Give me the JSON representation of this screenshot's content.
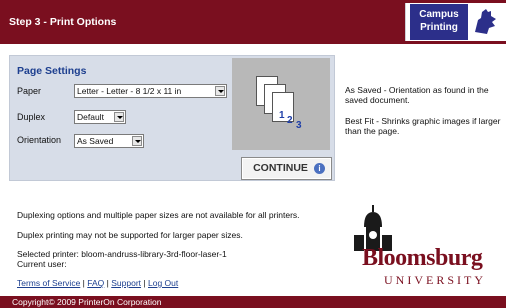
{
  "header": {
    "title": "Step 3 - Print Options",
    "logo_text_line1": "Campus",
    "logo_text_line2": "Printing",
    "color": "#7a0f1f"
  },
  "page_settings": {
    "title": "Page Settings",
    "paper_label": "Paper",
    "paper_value": "Letter - Letter - 8 1/2 x 11 in",
    "duplex_label": "Duplex",
    "duplex_value": "Default",
    "orientation_label": "Orientation",
    "orientation_value": "As Saved"
  },
  "preview": {
    "page_numbers": [
      "1",
      "2",
      "3"
    ]
  },
  "continue_label": "CONTINUE",
  "descriptions": [
    "As Saved - Orientation as found in the saved document.",
    "Best Fit - Shrinks graphic images if larger than the page."
  ],
  "notes": {
    "line1": "Duplexing options and multiple paper sizes are not available for all printers.",
    "line2": "Duplex printing may not be supported for larger paper sizes.",
    "printer": "Selected printer: bloom-andruss-library-3rd-floor-laser-1",
    "user": "Current user:"
  },
  "links": {
    "terms": "Terms of Service",
    "faq": "FAQ",
    "support": "Support",
    "logout": "Log Out",
    "separator": "|"
  },
  "logo": {
    "word": "Bloomsburg",
    "univ": "UNIVERSITY"
  },
  "footer": "Copyright© 2009 PrinterOn Corporation"
}
